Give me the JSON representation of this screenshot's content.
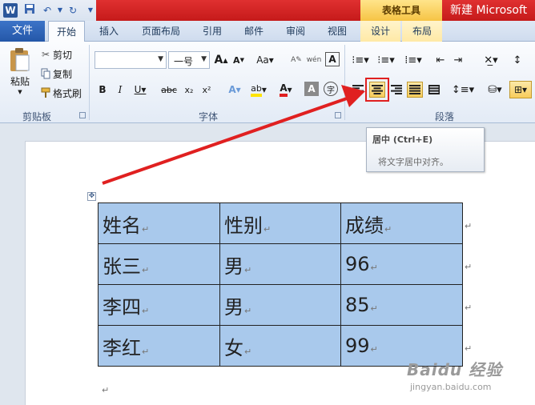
{
  "titlebar": {
    "tools_tab": "表格工具",
    "doc_title": "新建 Microsoft"
  },
  "tabs": [
    {
      "label": "文件"
    },
    {
      "label": "开始"
    },
    {
      "label": "插入"
    },
    {
      "label": "页面布局"
    },
    {
      "label": "引用"
    },
    {
      "label": "邮件"
    },
    {
      "label": "审阅"
    },
    {
      "label": "视图"
    },
    {
      "label": "设计"
    },
    {
      "label": "布局"
    }
  ],
  "clipboard": {
    "paste": "粘贴",
    "cut": "剪切",
    "copy": "复制",
    "format_painter": "格式刷",
    "group": "剪贴板"
  },
  "font": {
    "size_value": "一号",
    "group": "字体"
  },
  "paragraph": {
    "group": "段落"
  },
  "tooltip": {
    "title": "居中 (Ctrl+E)",
    "desc": "将文字居中对齐。"
  },
  "table": {
    "rows": [
      [
        "姓名",
        "性别",
        "成绩"
      ],
      [
        "张三",
        "男",
        "96"
      ],
      [
        "李四",
        "男",
        "85"
      ],
      [
        "李红",
        "女",
        "99"
      ]
    ]
  },
  "watermark": {
    "line1": "Baidu 经验",
    "line2": "jingyan.baidu.com"
  },
  "colors": {
    "accent_red": "#e02020",
    "selection_blue": "#a9c9ec",
    "file_tab_blue": "#2457a8",
    "tools_yellow": "#f6c445"
  }
}
